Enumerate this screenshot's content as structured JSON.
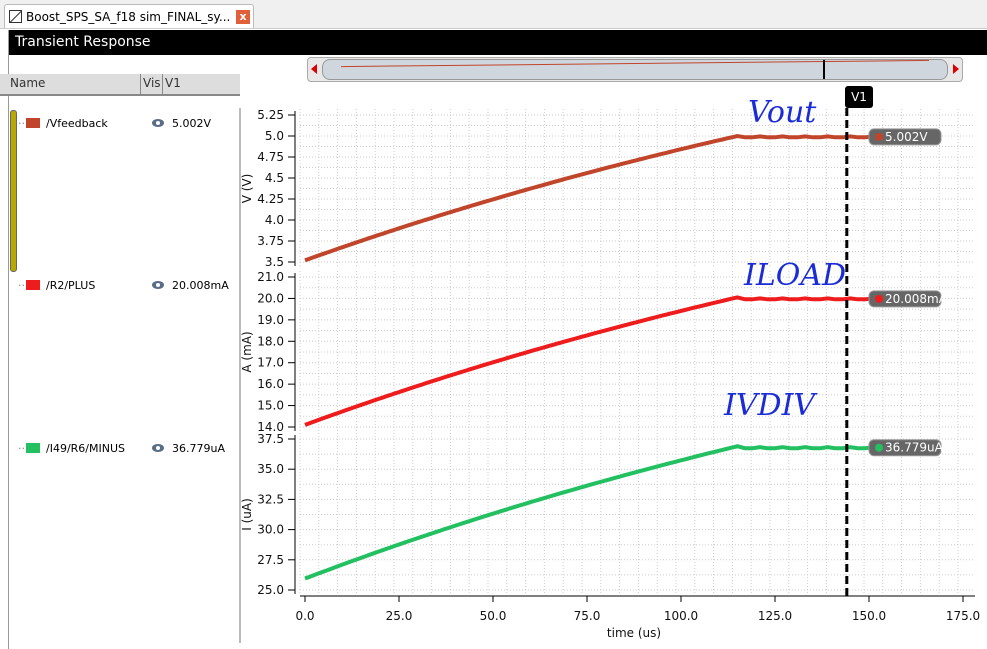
{
  "tab": {
    "title": "Boost_SPS_SA_f18 sim_FINAL_sy...",
    "close": "x"
  },
  "window": {
    "title": "Transient Response"
  },
  "columns": {
    "name": "Name",
    "vis": "Vis",
    "v1": "V1"
  },
  "signals": [
    {
      "name": "/Vfeedback",
      "value": "5.002V",
      "color": "#c0452a"
    },
    {
      "name": "/R2/PLUS",
      "value": "20.008mA",
      "color": "#ee1c1c"
    },
    {
      "name": "/I49/R6/MINUS",
      "value": "36.779uA",
      "color": "#22c060"
    }
  ],
  "cursor": {
    "label": "V1",
    "x": 144.1
  },
  "annotations": [
    "Vout",
    "ILOAD",
    "IVDIV"
  ],
  "chart_data": {
    "type": "line",
    "xlabel": "time (us)",
    "xlim": [
      0,
      175
    ],
    "xticks": [
      "0.0",
      "25.0",
      "50.0",
      "75.0",
      "100.0",
      "125.0",
      "150.0",
      "175.0"
    ],
    "panels": [
      {
        "ylabel": "V (V)",
        "ylim": [
          3.5,
          5.25
        ],
        "yticks": [
          "5.25",
          "5.0",
          "4.75",
          "4.5",
          "4.25",
          "4.0",
          "3.75",
          "3.5"
        ],
        "series": {
          "name": "/Vfeedback",
          "x": [
            0,
            115,
            170
          ],
          "y": [
            3.52,
            5.0,
            4.99
          ],
          "marker": "5.002V"
        }
      },
      {
        "ylabel": "A (mA)",
        "ylim": [
          14.0,
          21.0
        ],
        "yticks": [
          "21.0",
          "20.0",
          "19.0",
          "18.0",
          "17.0",
          "16.0",
          "15.0",
          "14.0"
        ],
        "series": {
          "name": "/R2/PLUS",
          "x": [
            0,
            115,
            170
          ],
          "y": [
            14.1,
            20.05,
            19.98
          ],
          "marker": "20.008mA"
        }
      },
      {
        "ylabel": "I (uA)",
        "ylim": [
          25.0,
          37.5
        ],
        "yticks": [
          "37.5",
          "35.0",
          "32.5",
          "30.0",
          "27.5",
          "25.0"
        ],
        "series": {
          "name": "/I49/R6/MINUS",
          "x": [
            0,
            115,
            170
          ],
          "y": [
            25.95,
            36.9,
            36.78
          ],
          "marker": "36.779uA"
        }
      }
    ]
  }
}
